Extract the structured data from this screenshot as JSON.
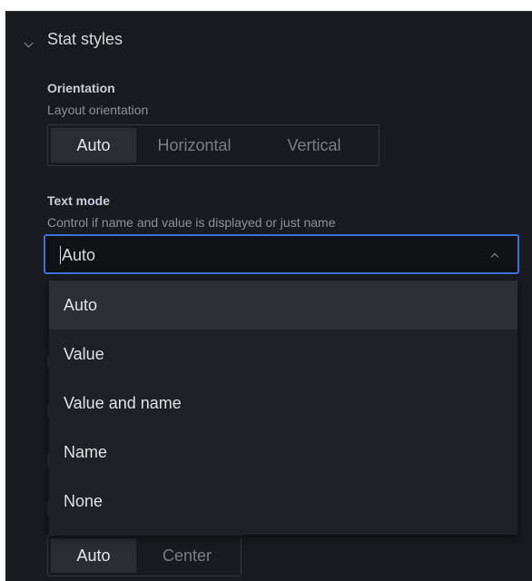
{
  "section": {
    "title": "Stat styles"
  },
  "orientation": {
    "label": "Orientation",
    "description": "Layout orientation",
    "options": [
      "Auto",
      "Horizontal",
      "Vertical"
    ],
    "selected": "Auto"
  },
  "text_mode": {
    "label": "Text mode",
    "description": "Control if name and value is displayed or just name",
    "value": "Auto",
    "options": [
      "Auto",
      "Value",
      "Value and name",
      "Name",
      "None"
    ],
    "highlighted": "Auto"
  },
  "alignment": {
    "options": [
      "Auto",
      "Center"
    ],
    "selected": "Auto"
  }
}
